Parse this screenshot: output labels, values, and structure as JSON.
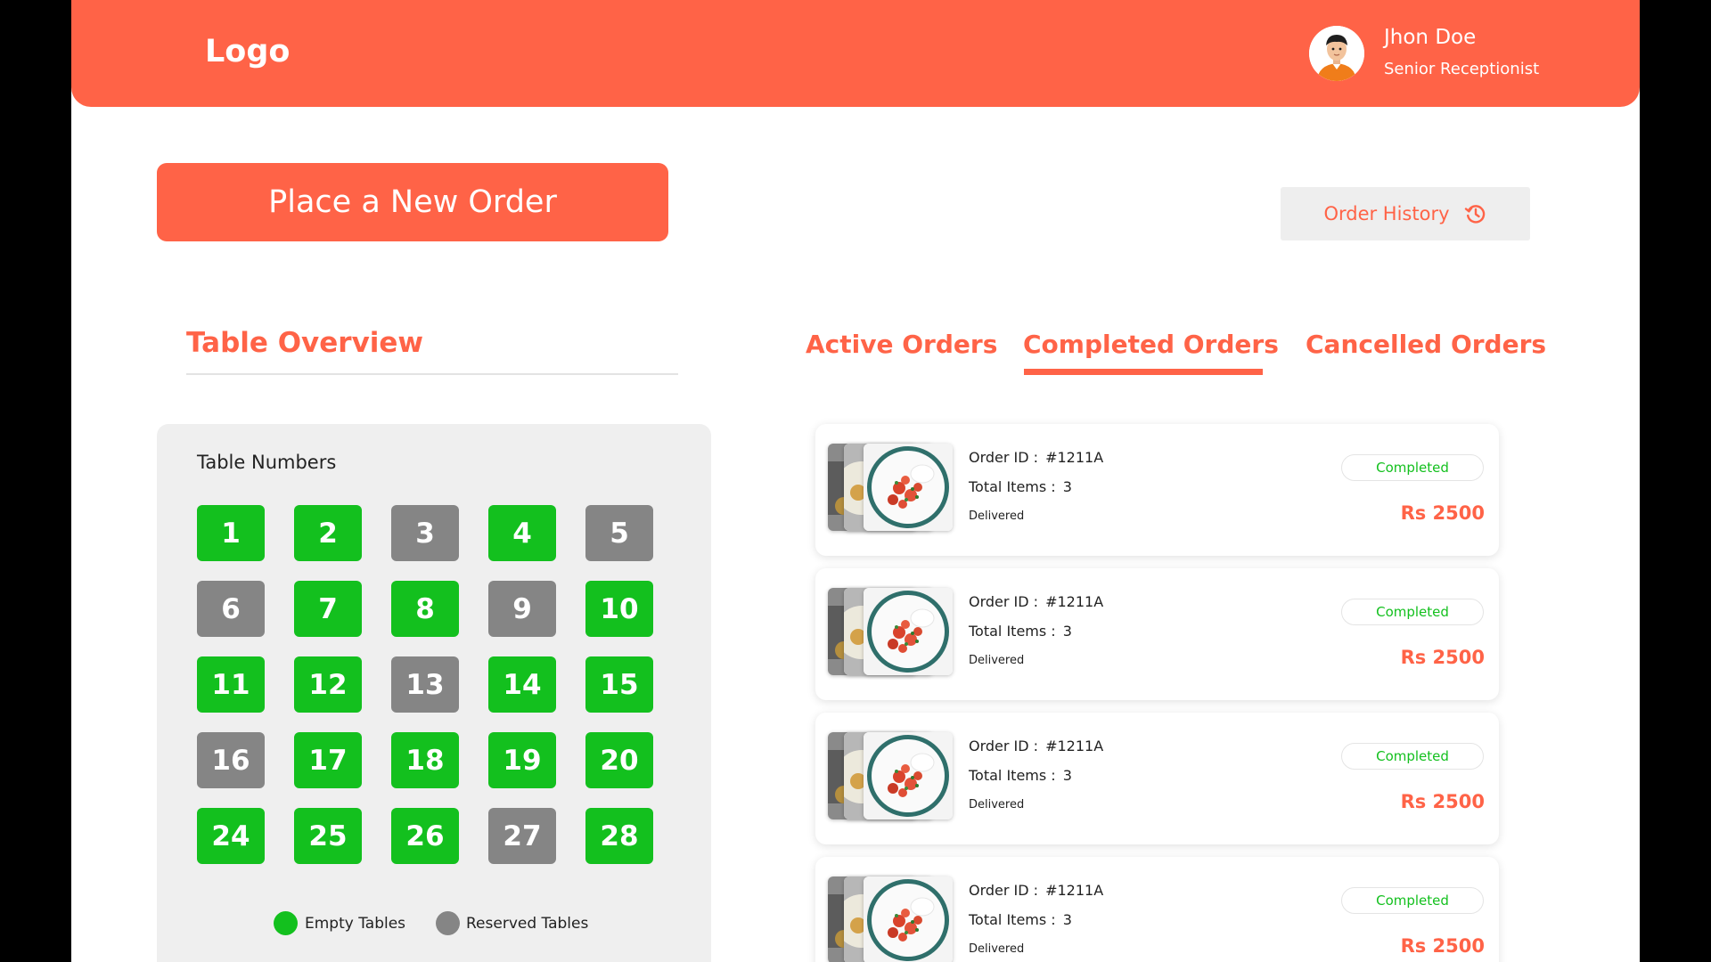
{
  "header": {
    "logo": "Logo",
    "user": {
      "name": "Jhon Doe",
      "role": "Senior Receptionist"
    }
  },
  "actions": {
    "new_order_label": "Place a New Order",
    "history_label": "Order History",
    "history_icon": "history-icon"
  },
  "tables": {
    "section_title": "Table Overview",
    "panel_title": "Table Numbers",
    "items": [
      {
        "number": "1",
        "status": "empty"
      },
      {
        "number": "2",
        "status": "empty"
      },
      {
        "number": "3",
        "status": "reserved"
      },
      {
        "number": "4",
        "status": "empty"
      },
      {
        "number": "5",
        "status": "reserved"
      },
      {
        "number": "6",
        "status": "reserved"
      },
      {
        "number": "7",
        "status": "empty"
      },
      {
        "number": "8",
        "status": "empty"
      },
      {
        "number": "9",
        "status": "reserved"
      },
      {
        "number": "10",
        "status": "empty"
      },
      {
        "number": "11",
        "status": "empty"
      },
      {
        "number": "12",
        "status": "empty"
      },
      {
        "number": "13",
        "status": "reserved"
      },
      {
        "number": "14",
        "status": "empty"
      },
      {
        "number": "15",
        "status": "empty"
      },
      {
        "number": "16",
        "status": "reserved"
      },
      {
        "number": "17",
        "status": "empty"
      },
      {
        "number": "18",
        "status": "empty"
      },
      {
        "number": "19",
        "status": "empty"
      },
      {
        "number": "20",
        "status": "empty"
      },
      {
        "number": "24",
        "status": "empty"
      },
      {
        "number": "25",
        "status": "empty"
      },
      {
        "number": "26",
        "status": "empty"
      },
      {
        "number": "27",
        "status": "reserved"
      },
      {
        "number": "28",
        "status": "empty"
      }
    ],
    "legend": [
      {
        "label": "Empty Tables",
        "color": "#13c01e"
      },
      {
        "label": "Reserved Tables",
        "color": "#858585"
      }
    ]
  },
  "orders": {
    "tabs": [
      {
        "label": "Active Orders",
        "active": false
      },
      {
        "label": "Completed Orders",
        "active": true
      },
      {
        "label": "Cancelled Orders",
        "active": false
      }
    ],
    "items": [
      {
        "id_label": "Order ID :",
        "id": "#1211A",
        "items_label": "Total Items :",
        "items": "3",
        "note": "Delivered",
        "status": "Completed",
        "price": "Rs 2500"
      },
      {
        "id_label": "Order ID :",
        "id": "#1211A",
        "items_label": "Total Items :",
        "items": "3",
        "note": "Delivered",
        "status": "Completed",
        "price": "Rs 2500"
      },
      {
        "id_label": "Order ID :",
        "id": "#1211A",
        "items_label": "Total Items :",
        "items": "3",
        "note": "Delivered",
        "status": "Completed",
        "price": "Rs 2500"
      },
      {
        "id_label": "Order ID :",
        "id": "#1211A",
        "items_label": "Total Items :",
        "items": "3",
        "note": "Delivered",
        "status": "Completed",
        "price": "Rs 2500"
      }
    ]
  },
  "colors": {
    "brand": "#ff6347",
    "empty": "#13c01e",
    "reserved": "#858585",
    "panel": "#efefef"
  }
}
